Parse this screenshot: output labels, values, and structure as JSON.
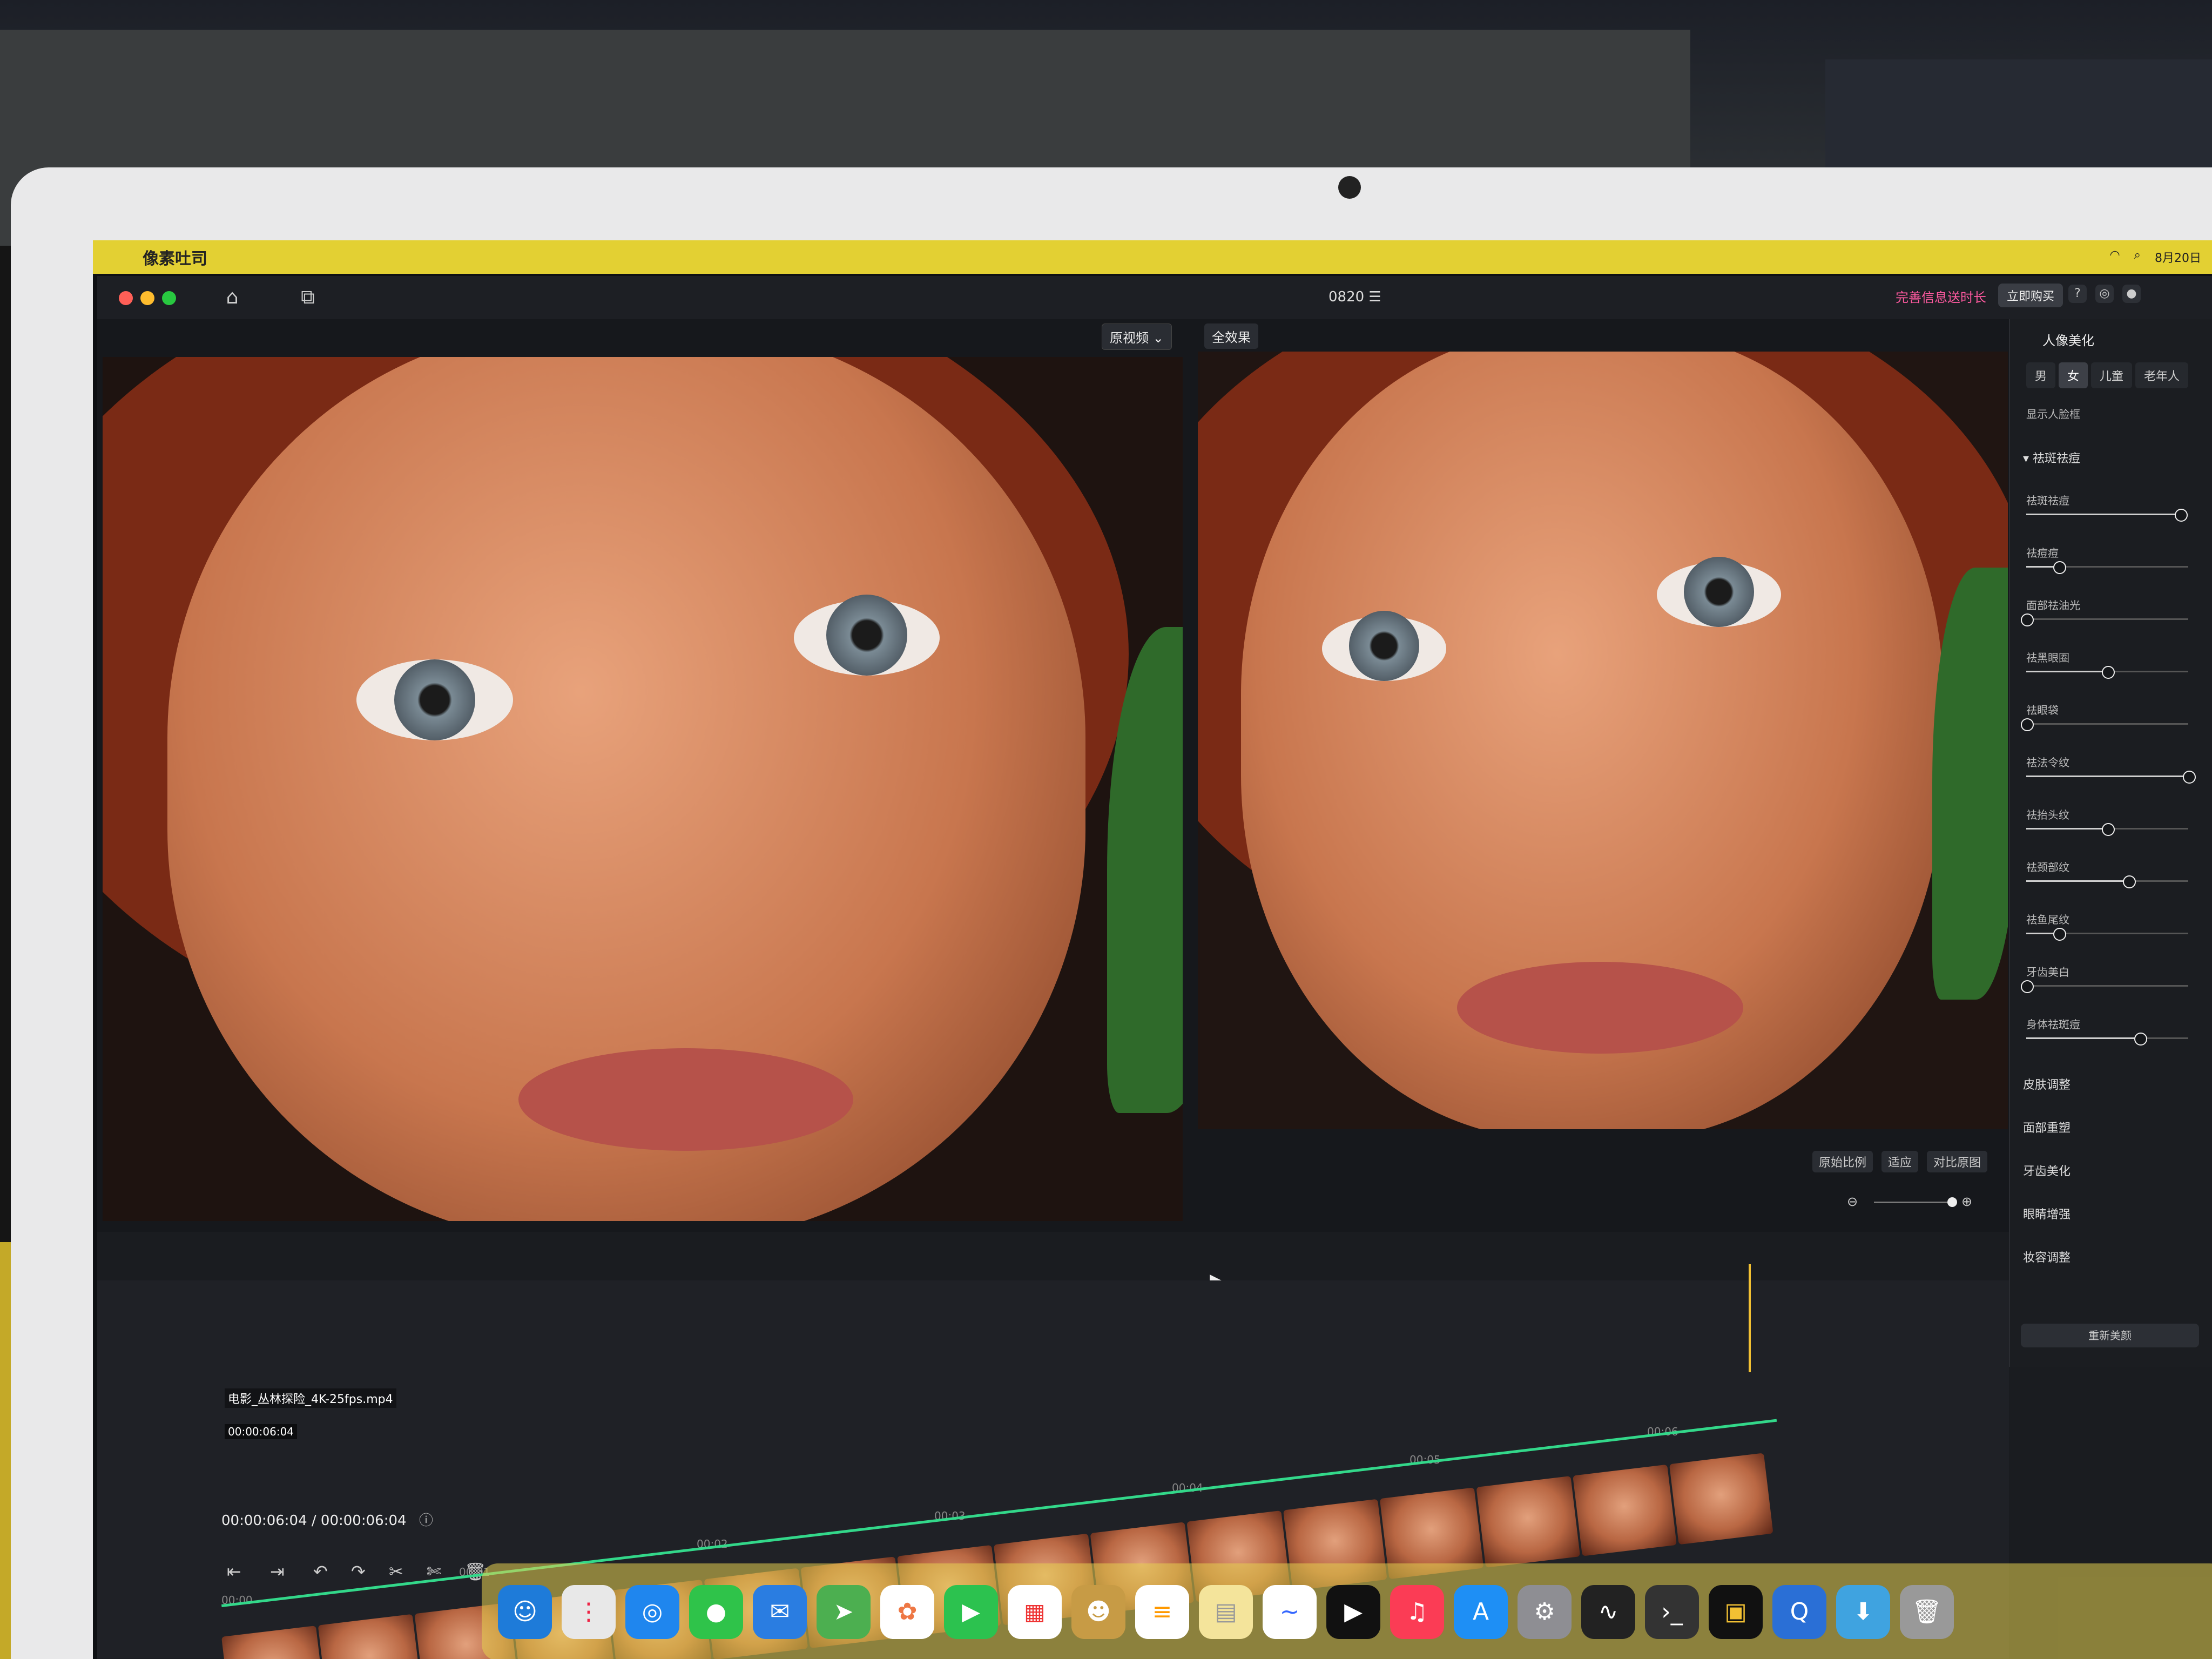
{
  "menubar": {
    "app_name": "像素吐司",
    "clock": "8月20日"
  },
  "window": {
    "project_name": "0820 ☰",
    "promo": "完善信息送时长",
    "buy_label": "立即购买"
  },
  "preview": {
    "view_mode": "原视频",
    "effect_label": "全效果",
    "bottom_tools": [
      "原始比例",
      "适应",
      "对比原图"
    ]
  },
  "panel": {
    "title": "人像美化",
    "segments": [
      "男",
      "女",
      "儿童",
      "老年人"
    ],
    "active_segment": "女",
    "show_face_label": "显示人脸框",
    "section_skin": "祛斑祛痘",
    "sliders": [
      {
        "label": "祛斑祛痘",
        "value": 95
      },
      {
        "label": "祛痘痘",
        "value": 20
      },
      {
        "label": "面部祛油光",
        "value": 0
      },
      {
        "label": "祛黑眼圈",
        "value": 50
      },
      {
        "label": "祛眼袋",
        "value": 0
      },
      {
        "label": "祛法令纹",
        "value": 100
      },
      {
        "label": "祛抬头纹",
        "value": 50
      },
      {
        "label": "祛颈部纹",
        "value": 63
      },
      {
        "label": "祛鱼尾纹",
        "value": 20
      },
      {
        "label": "牙齿美白",
        "value": 0
      },
      {
        "label": "身体祛斑痘",
        "value": 70
      }
    ],
    "collapsed_sections": [
      "皮肤调整",
      "面部重塑",
      "牙齿美化",
      "眼睛增强",
      "妆容调整"
    ],
    "reset_label": "重新美颜"
  },
  "timeline": {
    "current_time": "00:00:06:04",
    "total_time": "00:00:06:04",
    "ruler": [
      "00:00",
      "00:01",
      "00:02",
      "00:03",
      "00:04",
      "00:05",
      "00:06"
    ],
    "clip_name": "电影_丛林探险_4K-25fps.mp4",
    "clip_duration": "00:00:06:04"
  }
}
